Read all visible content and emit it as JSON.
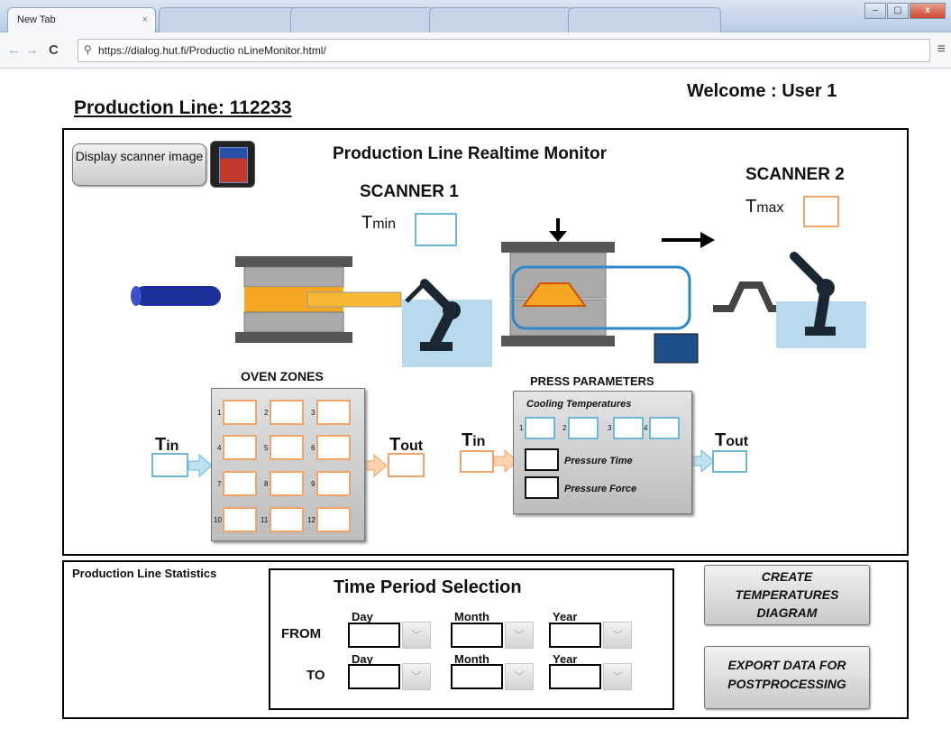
{
  "browser": {
    "active_tab": "New Tab",
    "tab_close": "×",
    "url": "https://dialog.hut.fi/Productio nLineMonitor.html/",
    "back": "←",
    "forward": "→",
    "reload": "C",
    "search_glyph": "⚲",
    "menu": "≡",
    "win_min": "–",
    "win_max": "▢",
    "win_close": "x"
  },
  "page": {
    "line_title": "Production Line: 112233",
    "welcome": "Welcome : User 1"
  },
  "monitor": {
    "title": "Production Line Realtime Monitor",
    "display_scanner_button": "Display scanner image",
    "scanner1": {
      "label": "SCANNER 1",
      "t_main": "T",
      "t_sub": "min"
    },
    "scanner2": {
      "label": "SCANNER 2",
      "t_main": "T",
      "t_sub": "max"
    },
    "oven": {
      "title": "OVEN ZONES",
      "zones": [
        "1",
        "2",
        "3",
        "4",
        "5",
        "6",
        "7",
        "8",
        "9",
        "10",
        "11",
        "12"
      ],
      "t_in": {
        "main": "T",
        "sub": "in"
      },
      "t_out": {
        "main": "T",
        "sub": "out"
      }
    },
    "press": {
      "title": "PRESS PARAMETERS",
      "cooling_label": "Cooling Temperatures",
      "cooling_numbers": [
        "1",
        "2",
        "3",
        "4"
      ],
      "pressure_time": "Pressure Time",
      "pressure_force": "Pressure Force",
      "t_in": {
        "main": "T",
        "sub": "in"
      },
      "t_out": {
        "main": "T",
        "sub": "out"
      }
    }
  },
  "stats": {
    "title": "Production Line Statistics",
    "period_title": "Time Period Selection",
    "from_label": "FROM",
    "to_label": "TO",
    "day_label": "Day",
    "month_label": "Month",
    "year_label": "Year",
    "dropdown_glyph": "﹀",
    "create_button": "CREATE TEMPERATURES DIAGRAM",
    "export_button": "EXPORT DATA FOR POSTPROCESSING"
  },
  "colors": {
    "blue_box": "#6cb8d6",
    "orange_box": "#f0a46a",
    "heat_orange": "#f5a623",
    "robot": "#1b2633"
  }
}
